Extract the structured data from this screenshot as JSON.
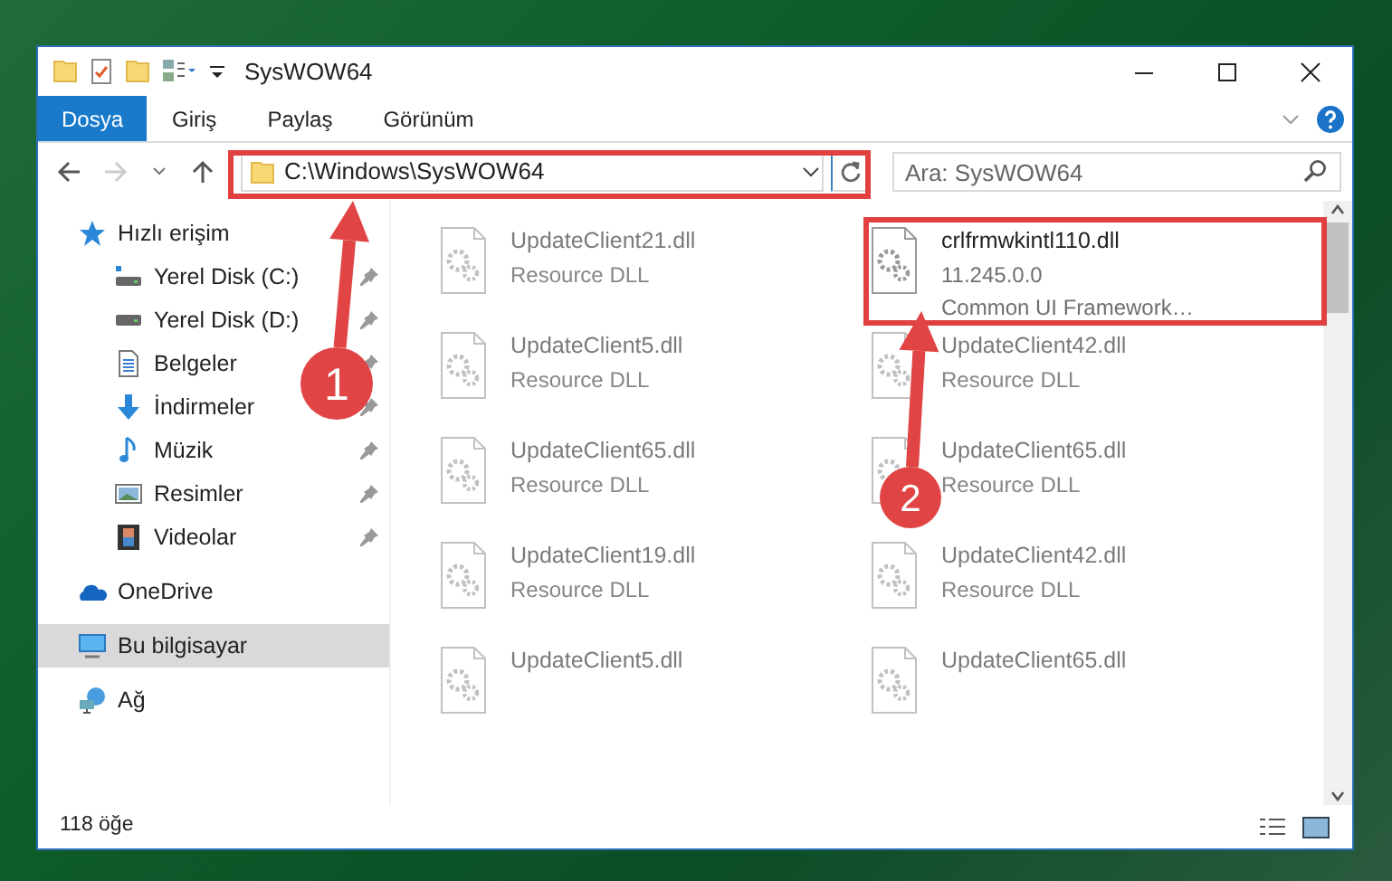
{
  "window": {
    "title": "SysWOW64"
  },
  "ribbon_tabs": [
    {
      "label": "Dosya",
      "selected": true
    },
    {
      "label": "Giriş",
      "selected": false
    },
    {
      "label": "Paylaş",
      "selected": false
    },
    {
      "label": "Görünüm",
      "selected": false
    }
  ],
  "address_bar": {
    "path": "C:\\Windows\\SysWOW64"
  },
  "search": {
    "placeholder": "Ara: SysWOW64"
  },
  "sidebar": {
    "items": [
      {
        "label": "Hızlı erişim",
        "kind": "star",
        "selected": false,
        "children": [
          {
            "label": "Yerel Disk (C:)",
            "kind": "drive-c",
            "pinned": true,
            "selected": false
          },
          {
            "label": "Yerel Disk (D:)",
            "kind": "drive",
            "pinned": true,
            "selected": false
          },
          {
            "label": "Belgeler",
            "kind": "document",
            "pinned": true,
            "selected": false
          },
          {
            "label": "İndirmeler",
            "kind": "download",
            "pinned": true,
            "selected": false
          },
          {
            "label": "Müzik",
            "kind": "music",
            "pinned": true,
            "selected": false
          },
          {
            "label": "Resimler",
            "kind": "pictures",
            "pinned": true,
            "selected": false
          },
          {
            "label": "Videolar",
            "kind": "videos",
            "pinned": true,
            "selected": false
          }
        ]
      },
      {
        "label": "OneDrive",
        "kind": "cloud",
        "selected": false
      },
      {
        "label": "Bu bilgisayar",
        "kind": "computer",
        "selected": true
      },
      {
        "label": "Ağ",
        "kind": "network",
        "selected": false
      }
    ]
  },
  "files": [
    {
      "name": "UpdateClient21.dll",
      "lines": [
        "Resource DLL"
      ],
      "dimmed": true
    },
    {
      "name": "crlfrmwkintl110.dll",
      "lines": [
        "11.245.0.0",
        "Common UI Framework…"
      ],
      "dimmed": false
    },
    {
      "name": "UpdateClient5.dll",
      "lines": [
        "Resource DLL"
      ],
      "dimmed": true
    },
    {
      "name": "UpdateClient42.dll",
      "lines": [
        "Resource DLL"
      ],
      "dimmed": true
    },
    {
      "name": "UpdateClient65.dll",
      "lines": [
        "Resource DLL"
      ],
      "dimmed": true
    },
    {
      "name": "UpdateClient65.dll",
      "lines": [
        "Resource DLL"
      ],
      "dimmed": true
    },
    {
      "name": "UpdateClient19.dll",
      "lines": [
        "Resource DLL"
      ],
      "dimmed": true
    },
    {
      "name": "UpdateClient42.dll",
      "lines": [
        "Resource DLL"
      ],
      "dimmed": true
    },
    {
      "name": "UpdateClient5.dll",
      "dimmed": true
    },
    {
      "name": "UpdateClient65.dll",
      "dimmed": true
    }
  ],
  "status_bar": {
    "count": "118 öğe"
  },
  "annotations": [
    {
      "label": "1"
    },
    {
      "label": "2"
    }
  ]
}
